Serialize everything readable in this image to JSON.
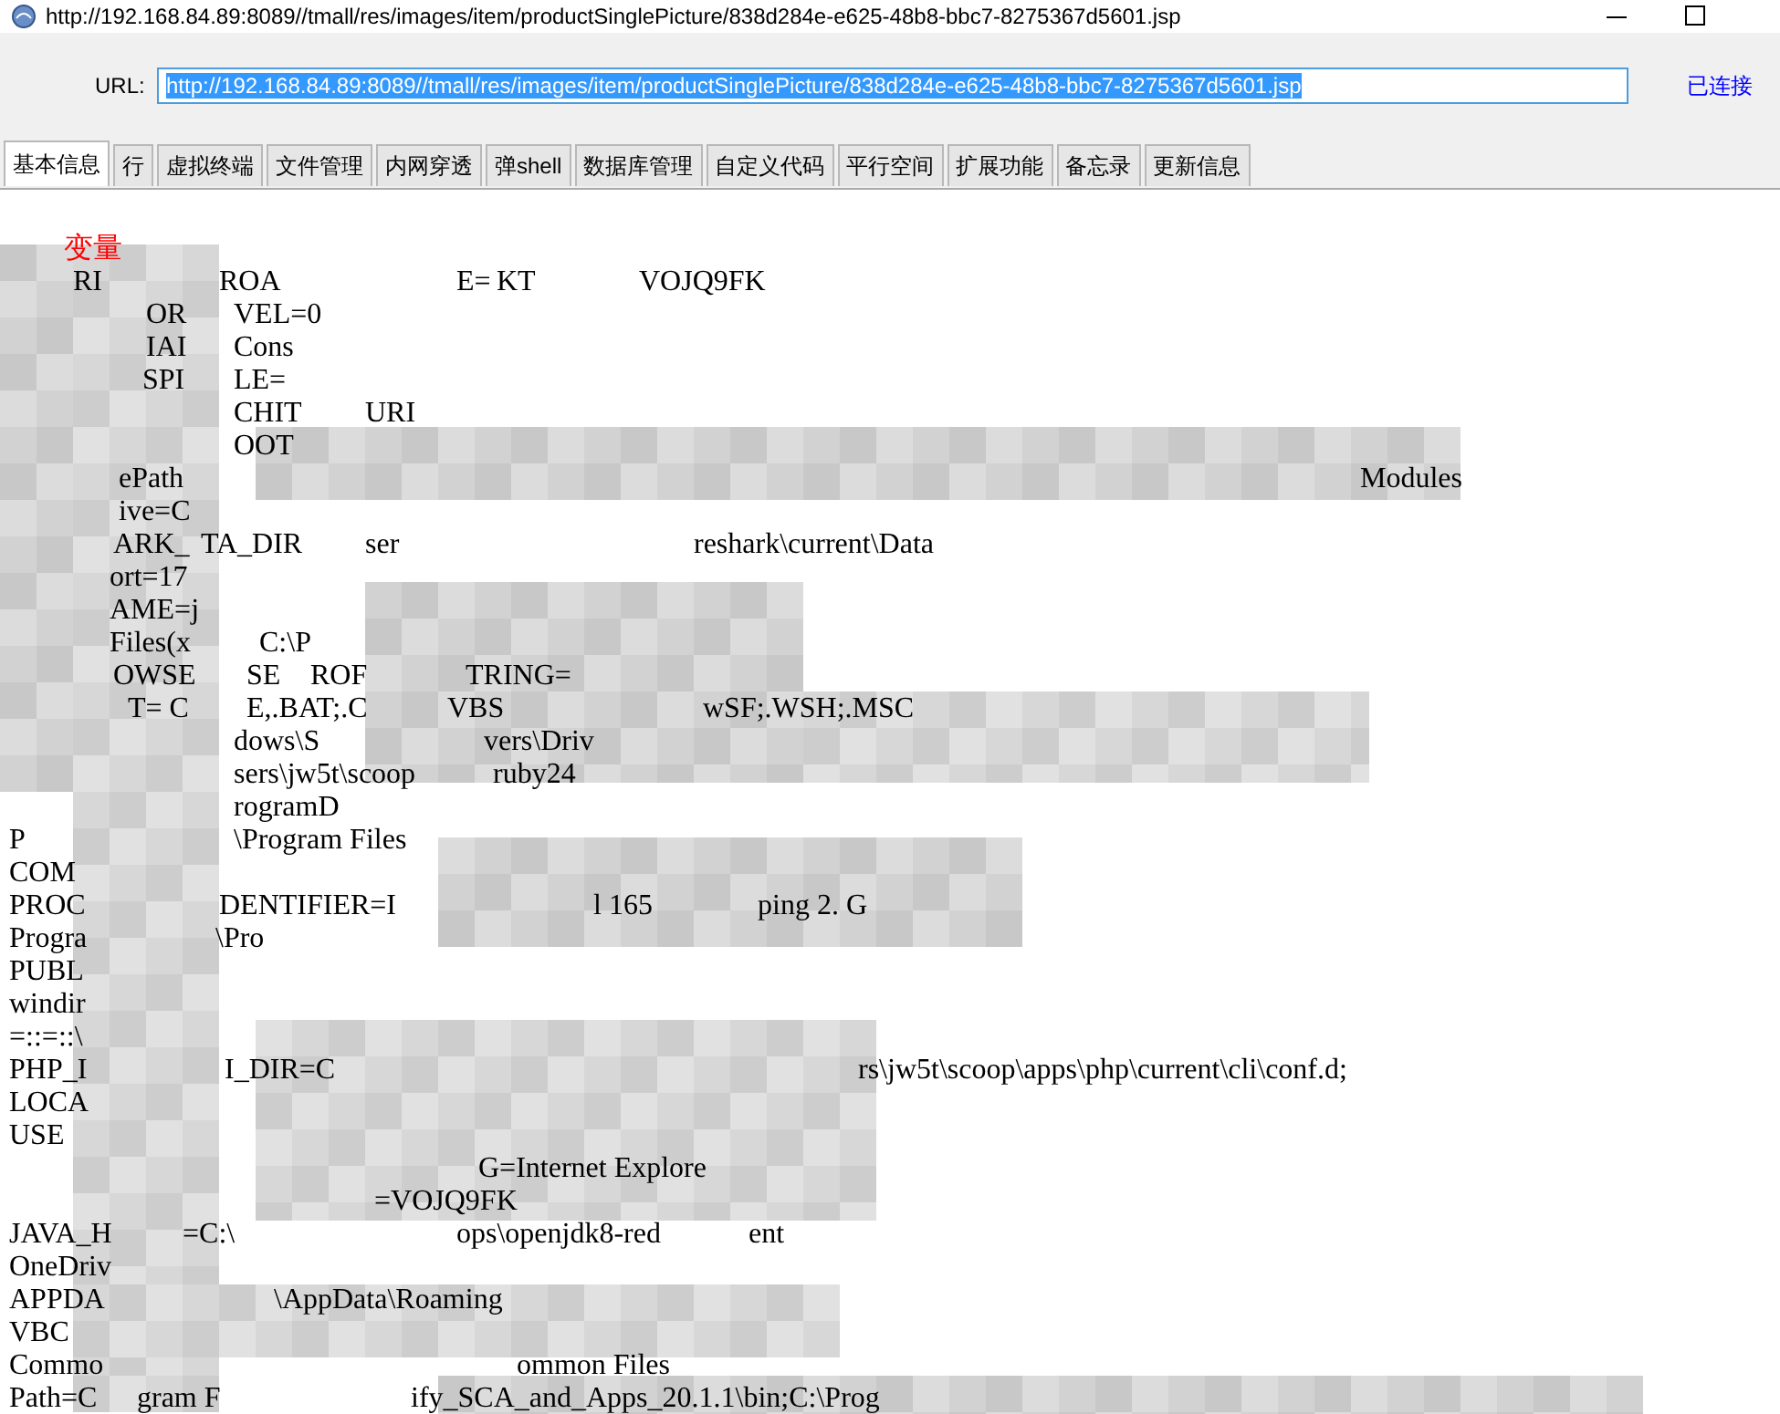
{
  "window": {
    "title": "http://192.168.84.89:8089//tmall/res/images/item/productSinglePicture/838d284e-e625-48b8-bbc7-8275367d5601.jsp"
  },
  "url_bar": {
    "label": "URL:",
    "value": "http://192.168.84.89:8089//tmall/res/images/item/productSinglePicture/838d284e-e625-48b8-bbc7-8275367d5601.jsp",
    "status": "已连接"
  },
  "tabs": [
    {
      "label": "基本信息",
      "selected": true
    },
    {
      "label": "行",
      "selected": false
    },
    {
      "label": "虚拟终端",
      "selected": false
    },
    {
      "label": "文件管理",
      "selected": false
    },
    {
      "label": "内网穿透",
      "selected": false
    },
    {
      "label": "弹shell",
      "selected": false
    },
    {
      "label": "数据库管理",
      "selected": false
    },
    {
      "label": "自定义代码",
      "selected": false
    },
    {
      "label": "平行空间",
      "selected": false
    },
    {
      "label": "扩展功能",
      "selected": false
    },
    {
      "label": "备忘录",
      "selected": false
    },
    {
      "label": "更新信息",
      "selected": false
    }
  ],
  "output_lines": [
    {
      "kind": "heading",
      "fragments": [
        "变量"
      ]
    },
    {
      "kind": "entry",
      "fragments": [
        "RI",
        "ROA",
        "E=",
        "KT",
        "VOJQ9FK"
      ]
    },
    {
      "kind": "entry",
      "fragments": [
        "OR",
        "VEL=0"
      ]
    },
    {
      "kind": "entry",
      "fragments": [
        "IAI",
        "Cons"
      ]
    },
    {
      "kind": "entry",
      "fragments": [
        "SPI",
        "LE="
      ]
    },
    {
      "kind": "entry",
      "fragments": [
        "CHIT",
        "URI"
      ]
    },
    {
      "kind": "entry",
      "fragments": [
        "OOT"
      ]
    },
    {
      "kind": "entry",
      "fragments": [
        "ePath",
        "Modules"
      ]
    },
    {
      "kind": "entry",
      "fragments": [
        "ive=C"
      ]
    },
    {
      "kind": "entry",
      "fragments": [
        "ARK_",
        "TA_DIR",
        "ser",
        "reshark\\current\\Data"
      ]
    },
    {
      "kind": "entry",
      "fragments": [
        "ort=17"
      ]
    },
    {
      "kind": "entry",
      "fragments": [
        "AME=j"
      ]
    },
    {
      "kind": "entry",
      "fragments": [
        "Files(x",
        "C:\\P"
      ]
    },
    {
      "kind": "entry",
      "fragments": [
        "OWSE",
        "SE",
        "ROF",
        "TRING="
      ]
    },
    {
      "kind": "entry",
      "fragments": [
        "T= C",
        "E,.BAT;.C",
        "VBS",
        "wSF;.WSH;.MSC"
      ]
    },
    {
      "kind": "entry",
      "fragments": [
        "dows\\S",
        "vers\\Driv"
      ]
    },
    {
      "kind": "entry",
      "fragments": [
        "sers\\jw5t\\scoop",
        "ruby24"
      ]
    },
    {
      "kind": "entry",
      "fragments": [
        "rogramD"
      ]
    },
    {
      "kind": "entry",
      "fragments": [
        "P",
        "\\Program Files"
      ]
    },
    {
      "kind": "entry",
      "fragments": [
        "COM"
      ]
    },
    {
      "kind": "entry",
      "fragments": [
        "PROC",
        "DENTIFIER=I",
        "l 165",
        "ping 2. G"
      ]
    },
    {
      "kind": "entry",
      "fragments": [
        "Progra",
        "\\Pro"
      ]
    },
    {
      "kind": "entry",
      "fragments": [
        "PUBL"
      ]
    },
    {
      "kind": "entry",
      "fragments": [
        "windir"
      ]
    },
    {
      "kind": "entry",
      "fragments": [
        "=::=::\\"
      ]
    },
    {
      "kind": "entry",
      "fragments": [
        "PHP_I",
        "I_DIR=C",
        "rs\\jw5t\\scoop\\apps\\php\\current\\cli\\conf.d;"
      ]
    },
    {
      "kind": "entry",
      "fragments": [
        "LOCA"
      ]
    },
    {
      "kind": "entry",
      "fragments": [
        "USE"
      ]
    },
    {
      "kind": "entry",
      "fragments": [
        "G=Internet Explore"
      ]
    },
    {
      "kind": "entry",
      "fragments": [
        "=VOJQ9FK"
      ]
    },
    {
      "kind": "entry",
      "fragments": [
        "JAVA_H",
        "=C:\\",
        "ops\\openjdk8-red",
        "ent"
      ]
    },
    {
      "kind": "entry",
      "fragments": [
        "OneDriv"
      ]
    },
    {
      "kind": "entry",
      "fragments": [
        "APPDA",
        "\\AppData\\Roaming"
      ]
    },
    {
      "kind": "entry",
      "fragments": [
        "VBC"
      ]
    },
    {
      "kind": "entry",
      "fragments": [
        "Commo",
        "ommon Files"
      ]
    },
    {
      "kind": "entry",
      "fragments": [
        "Path=C",
        "gram F",
        "ify_SCA_and_Apps_20.1.1\\bin;C:\\Prog"
      ]
    }
  ]
}
